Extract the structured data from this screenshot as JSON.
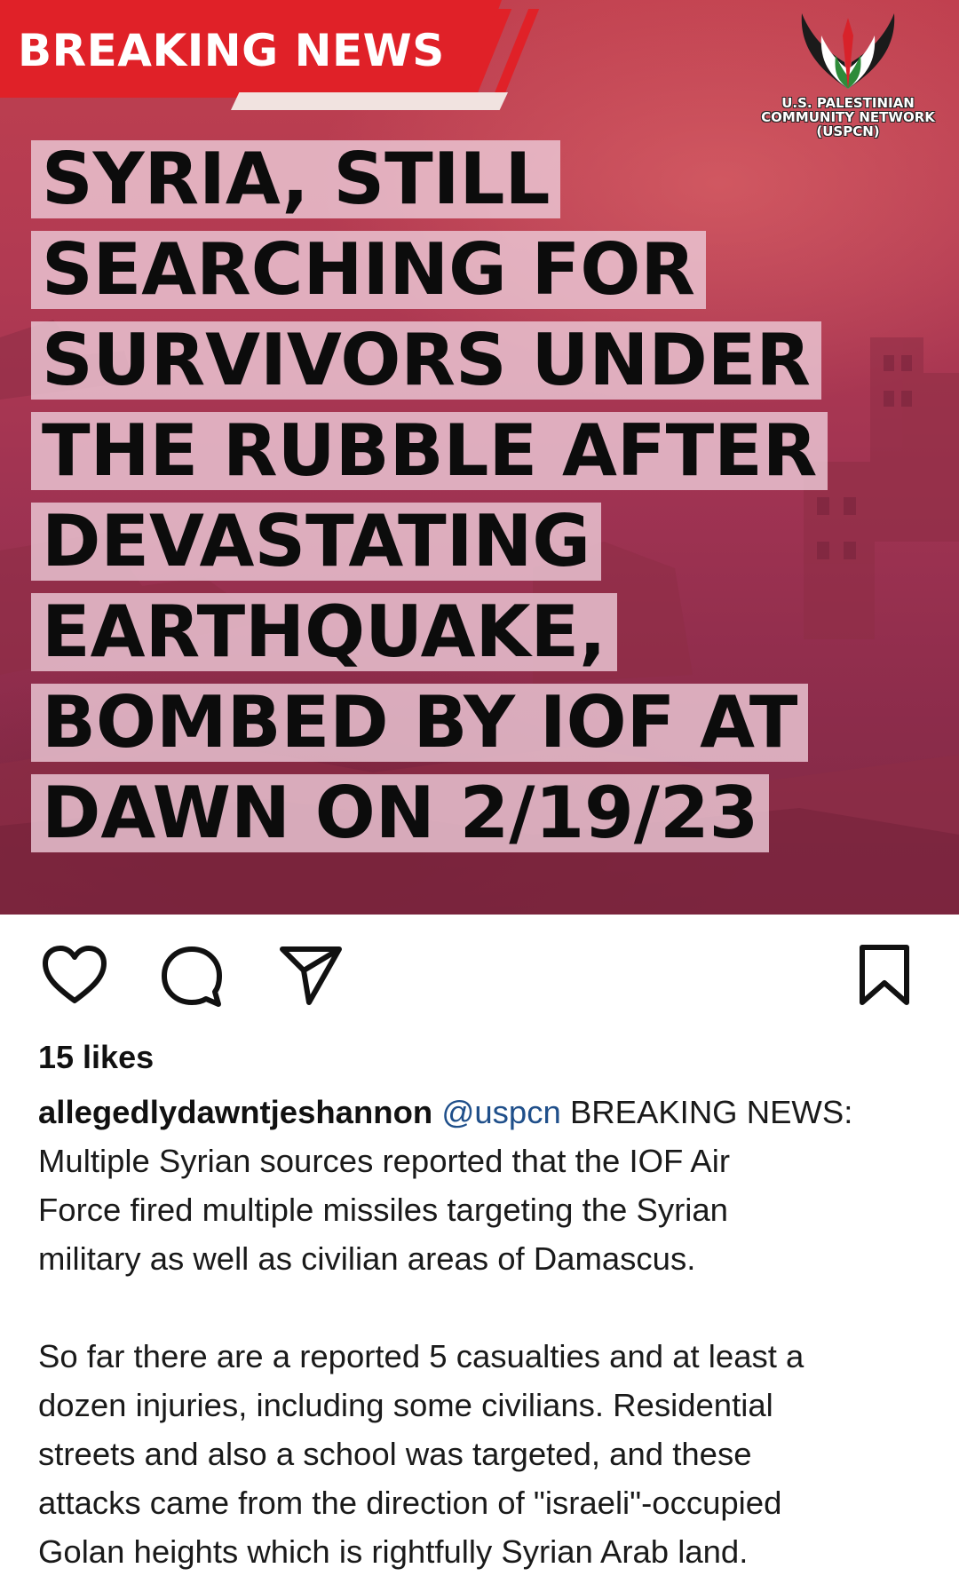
{
  "post": {
    "banner": "BREAKING NEWS",
    "logo_text": [
      "U.S. PALESTINIAN",
      "COMMUNITY NETWORK",
      "(USPCN)"
    ],
    "headline_lines": [
      "SYRIA, STILL",
      "SEARCHING FOR",
      "SURVIVORS UNDER",
      "THE RUBBLE AFTER",
      "DEVASTATING",
      "EARTHQUAKE,",
      "BOMBED BY IOF AT",
      "DAWN ON 2/19/23"
    ]
  },
  "actions": {
    "like_icon": "heart-icon",
    "comment_icon": "comment-icon",
    "share_icon": "send-icon",
    "save_icon": "bookmark-icon"
  },
  "likes": "15 likes",
  "caption": {
    "username": "allegedlydawntjeshannon",
    "mention": "@uspcn",
    "lines": [
      "BREAKING NEWS:",
      "Multiple Syrian sources reported that the IOF Air",
      "Force fired multiple missiles targeting the Syrian",
      "military as well as civilian areas of Damascus.",
      "So far there are a reported 5 casualties and at least a",
      "dozen injuries, including some civilians. Residential",
      "streets and also a school was targeted, and these",
      "attacks came from the direction of \"israeli\"-occupied",
      "Golan heights which is rightfully Syrian Arab land."
    ]
  },
  "colors": {
    "banner_red": "#e02128",
    "image_tint": "#b13a52",
    "highlight": "#ecc8d6",
    "mention_blue": "#1f4f8a"
  }
}
